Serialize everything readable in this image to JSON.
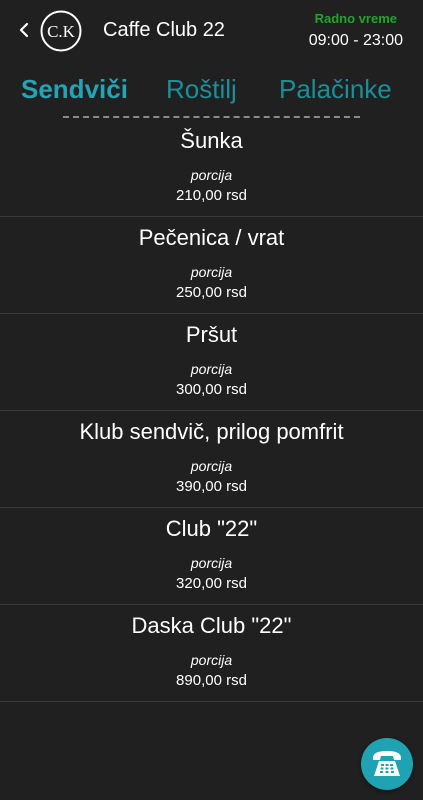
{
  "header": {
    "logo_text": "C.K",
    "title": "Caffe Club 22",
    "hours_label": "Radno vreme",
    "hours_value": "09:00 - 23:00"
  },
  "tabs": [
    {
      "label": "Sendviči",
      "active": true
    },
    {
      "label": "Roštilj",
      "active": false
    },
    {
      "label": "Palačinke",
      "active": false
    }
  ],
  "items": [
    {
      "name": "Šunka",
      "unit": "porcija",
      "price": "210,00 rsd"
    },
    {
      "name": "Pečenica / vrat",
      "unit": "porcija",
      "price": "250,00 rsd"
    },
    {
      "name": "Pršut",
      "unit": "porcija",
      "price": "300,00 rsd"
    },
    {
      "name": "Klub sendvič, prilog pomfrit",
      "unit": "porcija",
      "price": "390,00 rsd"
    },
    {
      "name": "Club \"22\"",
      "unit": "porcija",
      "price": "320,00 rsd"
    },
    {
      "name": "Daska Club \"22\"",
      "unit": "porcija",
      "price": "890,00 rsd"
    }
  ],
  "icons": {
    "back": "chevron-left-icon",
    "call": "phone-icon"
  },
  "colors": {
    "background": "#202020",
    "accent": "#22a4b5",
    "hours_label": "#1fa52a"
  }
}
